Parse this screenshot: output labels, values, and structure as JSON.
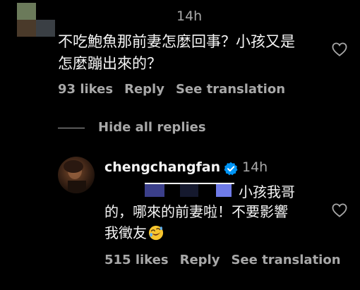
{
  "top_comment": {
    "time": "14h",
    "line1": "不吃鮑魚那前妻怎麼回事？小孩又是",
    "line2": "怎麼蹦出來的？",
    "likes": "93 likes",
    "reply_label": "Reply",
    "translate_label": "See translation",
    "avatar_colors": [
      "#6b7a5a",
      "#0d0d0d",
      "#4a3a2a",
      "#3a3f44"
    ]
  },
  "hide_replies_label": "Hide all replies",
  "reply": {
    "username": "chengchangfan",
    "time": "14h",
    "line1": "小孩我哥",
    "line2": "的，哪來的前妻啦！不要影響",
    "line3": "我徵友",
    "emoji_name": "rolling-on-floor-laughing",
    "likes": "515 likes",
    "reply_label": "Reply",
    "translate_label": "See translation"
  },
  "colors": {
    "background": "#000000",
    "text": "#f5f5f5",
    "muted": "#a8a8a8",
    "verified": "#0095f6",
    "redaction_blue": "#3b3f8a",
    "redaction_dark": "#15192e"
  }
}
